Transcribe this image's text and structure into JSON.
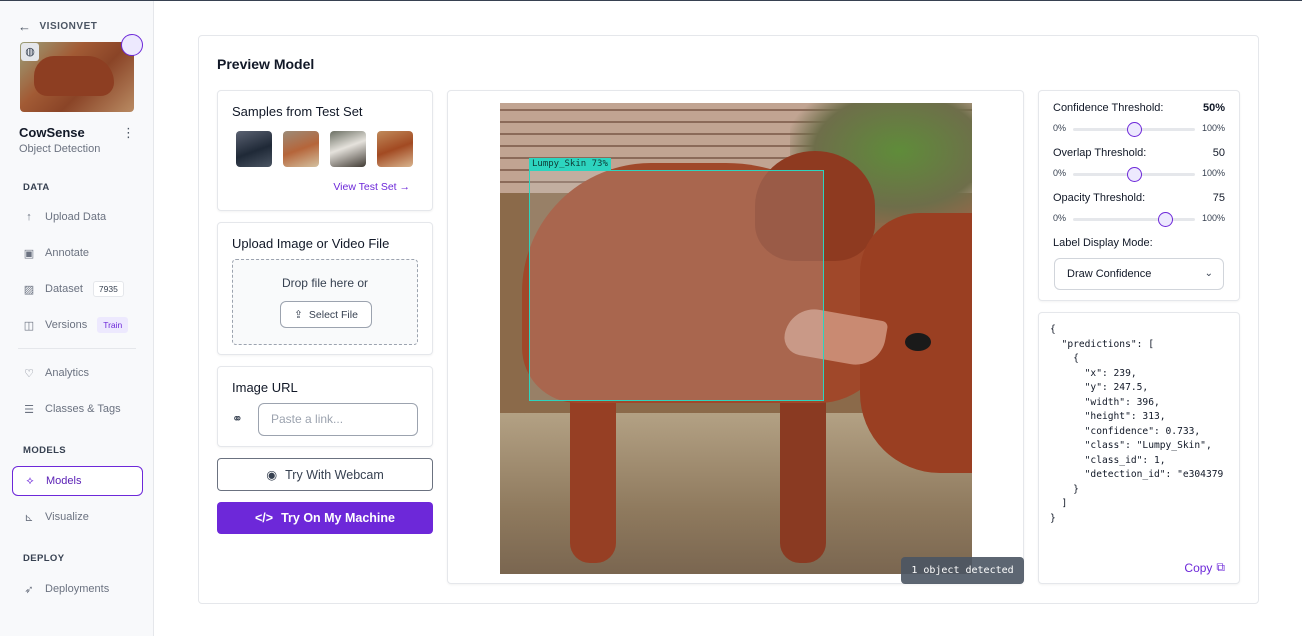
{
  "sidebar": {
    "back_label": "VISIONVET",
    "project_name": "CowSense",
    "project_type": "Object Detection",
    "sections": {
      "data": "DATA",
      "models": "MODELS",
      "deploy": "DEPLOY"
    },
    "items": [
      {
        "label": "Upload Data",
        "icon": "upload-icon"
      },
      {
        "label": "Annotate",
        "icon": "annotate-icon"
      },
      {
        "label": "Dataset",
        "icon": "dataset-icon",
        "badge": "7935"
      },
      {
        "label": "Versions",
        "icon": "versions-icon",
        "badge": "Train"
      },
      {
        "label": "Analytics",
        "icon": "analytics-icon"
      },
      {
        "label": "Classes & Tags",
        "icon": "classes-icon"
      },
      {
        "label": "Models",
        "icon": "models-icon",
        "active": true
      },
      {
        "label": "Visualize",
        "icon": "visualize-icon"
      },
      {
        "label": "Deployments",
        "icon": "rocket-icon"
      }
    ]
  },
  "page": {
    "title": "Preview Model"
  },
  "samples": {
    "title": "Samples from Test Set",
    "view_link": "View Test Set →"
  },
  "upload": {
    "title": "Upload Image or Video File",
    "drop_text": "Drop file here or",
    "select_label": "Select File"
  },
  "image_url": {
    "title": "Image URL",
    "placeholder": "Paste a link..."
  },
  "actions": {
    "webcam_label": "Try With Webcam",
    "machine_label": "Try On My Machine"
  },
  "preview": {
    "bbox_label": "Lumpy_Skin 73%",
    "detected_label": "1 object detected"
  },
  "thresholds": {
    "confidence": {
      "label": "Confidence Threshold:",
      "value": "50%",
      "level": 50
    },
    "overlap": {
      "label": "Overlap Threshold:",
      "value": "50",
      "level": 50
    },
    "opacity": {
      "label": "Opacity Threshold:",
      "value": "75",
      "level": 75
    },
    "min_label": "0%",
    "max_label": "100%",
    "label_mode_title": "Label Display Mode:",
    "label_mode_value": "Draw Confidence"
  },
  "output": {
    "json_text": "{\n  \"predictions\": [\n    {\n      \"x\": 239,\n      \"y\": 247.5,\n      \"width\": 396,\n      \"height\": 313,\n      \"confidence\": 0.733,\n      \"class\": \"Lumpy_Skin\",\n      \"class_id\": 1,\n      \"detection_id\": \"e304379\n    }\n  ]\n}",
    "copy_label": "Copy"
  },
  "colors": {
    "accent": "#6d28d9",
    "bbox": "#2dd4bf"
  }
}
